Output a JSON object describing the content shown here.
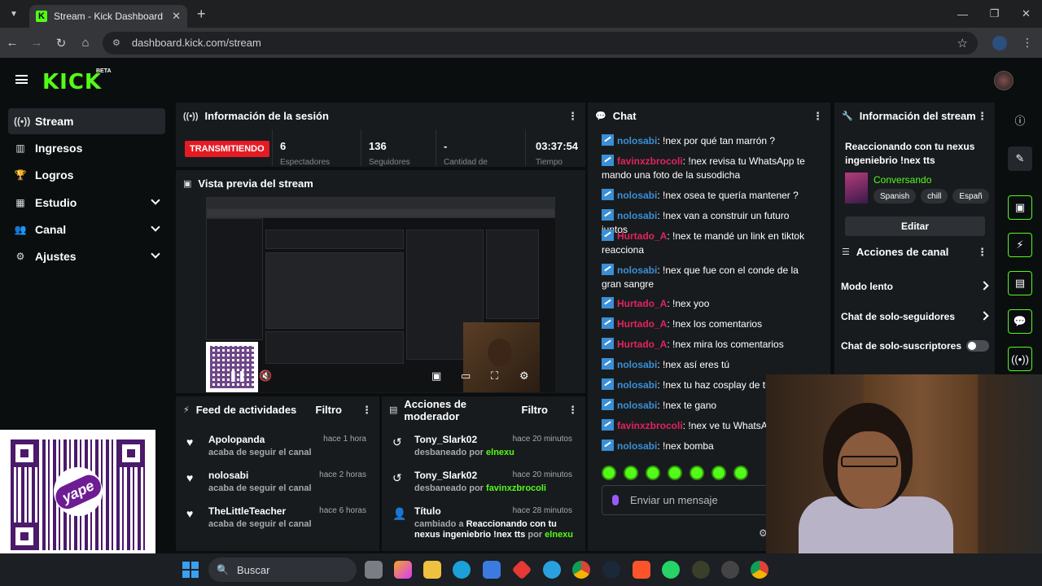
{
  "browser": {
    "tab_title": "Stream - Kick Dashboard",
    "url": "dashboard.kick.com/stream"
  },
  "brand": {
    "logo": "KICK",
    "beta": "BETA",
    "accent": "#53fc18"
  },
  "sidebar": {
    "items": [
      {
        "label": "Stream",
        "icon": "broadcast-icon",
        "active": true
      },
      {
        "label": "Ingresos",
        "icon": "chart-icon"
      },
      {
        "label": "Logros",
        "icon": "trophy-icon"
      },
      {
        "label": "Estudio",
        "icon": "studio-icon"
      },
      {
        "label": "Canal",
        "icon": "users-icon"
      },
      {
        "label": "Ajustes",
        "icon": "gear-icon"
      }
    ]
  },
  "session": {
    "title": "Información de la sesión",
    "status": "TRANSMITIENDO",
    "stats": [
      {
        "value": "6",
        "label": "Espectadores"
      },
      {
        "value": "136",
        "label": "Seguidores"
      },
      {
        "value": "-",
        "label": "Cantidad de"
      },
      {
        "value": "03:37:54",
        "label": "Tiempo"
      }
    ]
  },
  "preview": {
    "title": "Vista previa del stream"
  },
  "feed": {
    "title": "Feed de actividades",
    "filter": "Filtro",
    "items": [
      {
        "name": "Apolopanda",
        "sub": "acaba de seguir el canal",
        "time": "hace 1 hora"
      },
      {
        "name": "nolosabi",
        "sub": "acaba de seguir el canal",
        "time": "hace 2 horas"
      },
      {
        "name": "TheLittleTeacher",
        "sub": "acaba de seguir el canal",
        "time": "hace 6 horas"
      }
    ]
  },
  "mod": {
    "title": "Acciones de moderador",
    "filter": "Filtro",
    "items": [
      {
        "name": "Tony_Slark02",
        "sub_prefix": "desbaneado por",
        "actor": "elnexu",
        "time": "hace 20 minutos"
      },
      {
        "name": "Tony_Slark02",
        "sub_prefix": "desbaneado por",
        "actor": "favinxzbrocoli",
        "time": "hace 20 minutos"
      },
      {
        "name": "Título",
        "sub_prefix": "cambiado a",
        "sub_value": "Reaccionando con tu nexus ingeniebrio !nex tts",
        "sub_mid": "por",
        "actor": "elnexu",
        "time": "hace 28 minutos"
      }
    ]
  },
  "chat": {
    "title": "Chat",
    "input_placeholder": "Enviar un mensaje",
    "messages": [
      {
        "user": "nolosabi",
        "color": "#3b8fd6",
        "text": "!nex por qué tan marrón ?"
      },
      {
        "user": "favinxzbrocoli",
        "color": "#e0245e",
        "text": "!nex revisa tu WhatsApp te mando una foto de la susodicha"
      },
      {
        "user": "nolosabi",
        "color": "#3b8fd6",
        "text": "!nex osea te quería mantener ?"
      },
      {
        "user": "nolosabi",
        "color": "#3b8fd6",
        "text": "!nex van a construir un futuro juntos"
      },
      {
        "user": "Hurtado_A",
        "color": "#e0245e",
        "text": "!nex te mandé un link en tiktok reacciona"
      },
      {
        "user": "nolosabi",
        "color": "#3b8fd6",
        "text": "!nex que fue con el conde de la gran sangre"
      },
      {
        "user": "Hurtado_A",
        "color": "#e0245e",
        "text": "!nex yoo"
      },
      {
        "user": "Hurtado_A",
        "color": "#e0245e",
        "text": "!nex los comentarios"
      },
      {
        "user": "Hurtado_A",
        "color": "#e0245e",
        "text": "!nex mira los comentarios"
      },
      {
        "user": "nolosabi",
        "color": "#3b8fd6",
        "text": "!nex así eres tú"
      },
      {
        "user": "nolosabi",
        "color": "#3b8fd6",
        "text": "!nex tu haz cosplay de tu p"
      },
      {
        "user": "nolosabi",
        "color": "#3b8fd6",
        "text": "!nex te gano"
      },
      {
        "user": "favinxzbrocoli",
        "color": "#e0245e",
        "text": "!nex ve tu WhatsApp"
      },
      {
        "user": "nolosabi",
        "color": "#3b8fd6",
        "text": "!nex bomba"
      }
    ]
  },
  "stream_info": {
    "title": "Información del stream",
    "stream_title": "Reaccionando con tu nexus ingeniebrio !nex tts",
    "category": "Conversando",
    "tags": [
      "Spanish",
      "chill",
      "Españ"
    ],
    "edit": "Editar"
  },
  "channel_actions": {
    "title": "Acciones de canal",
    "items": [
      {
        "label": "Modo lento",
        "kind": "arrow"
      },
      {
        "label": "Chat de solo-seguidores",
        "kind": "arrow"
      },
      {
        "label": "Chat de solo-suscriptores",
        "kind": "toggle"
      }
    ]
  },
  "qr": {
    "brand": "yape",
    "brand_color": "#6e1c94"
  },
  "taskbar": {
    "search": "Buscar"
  }
}
